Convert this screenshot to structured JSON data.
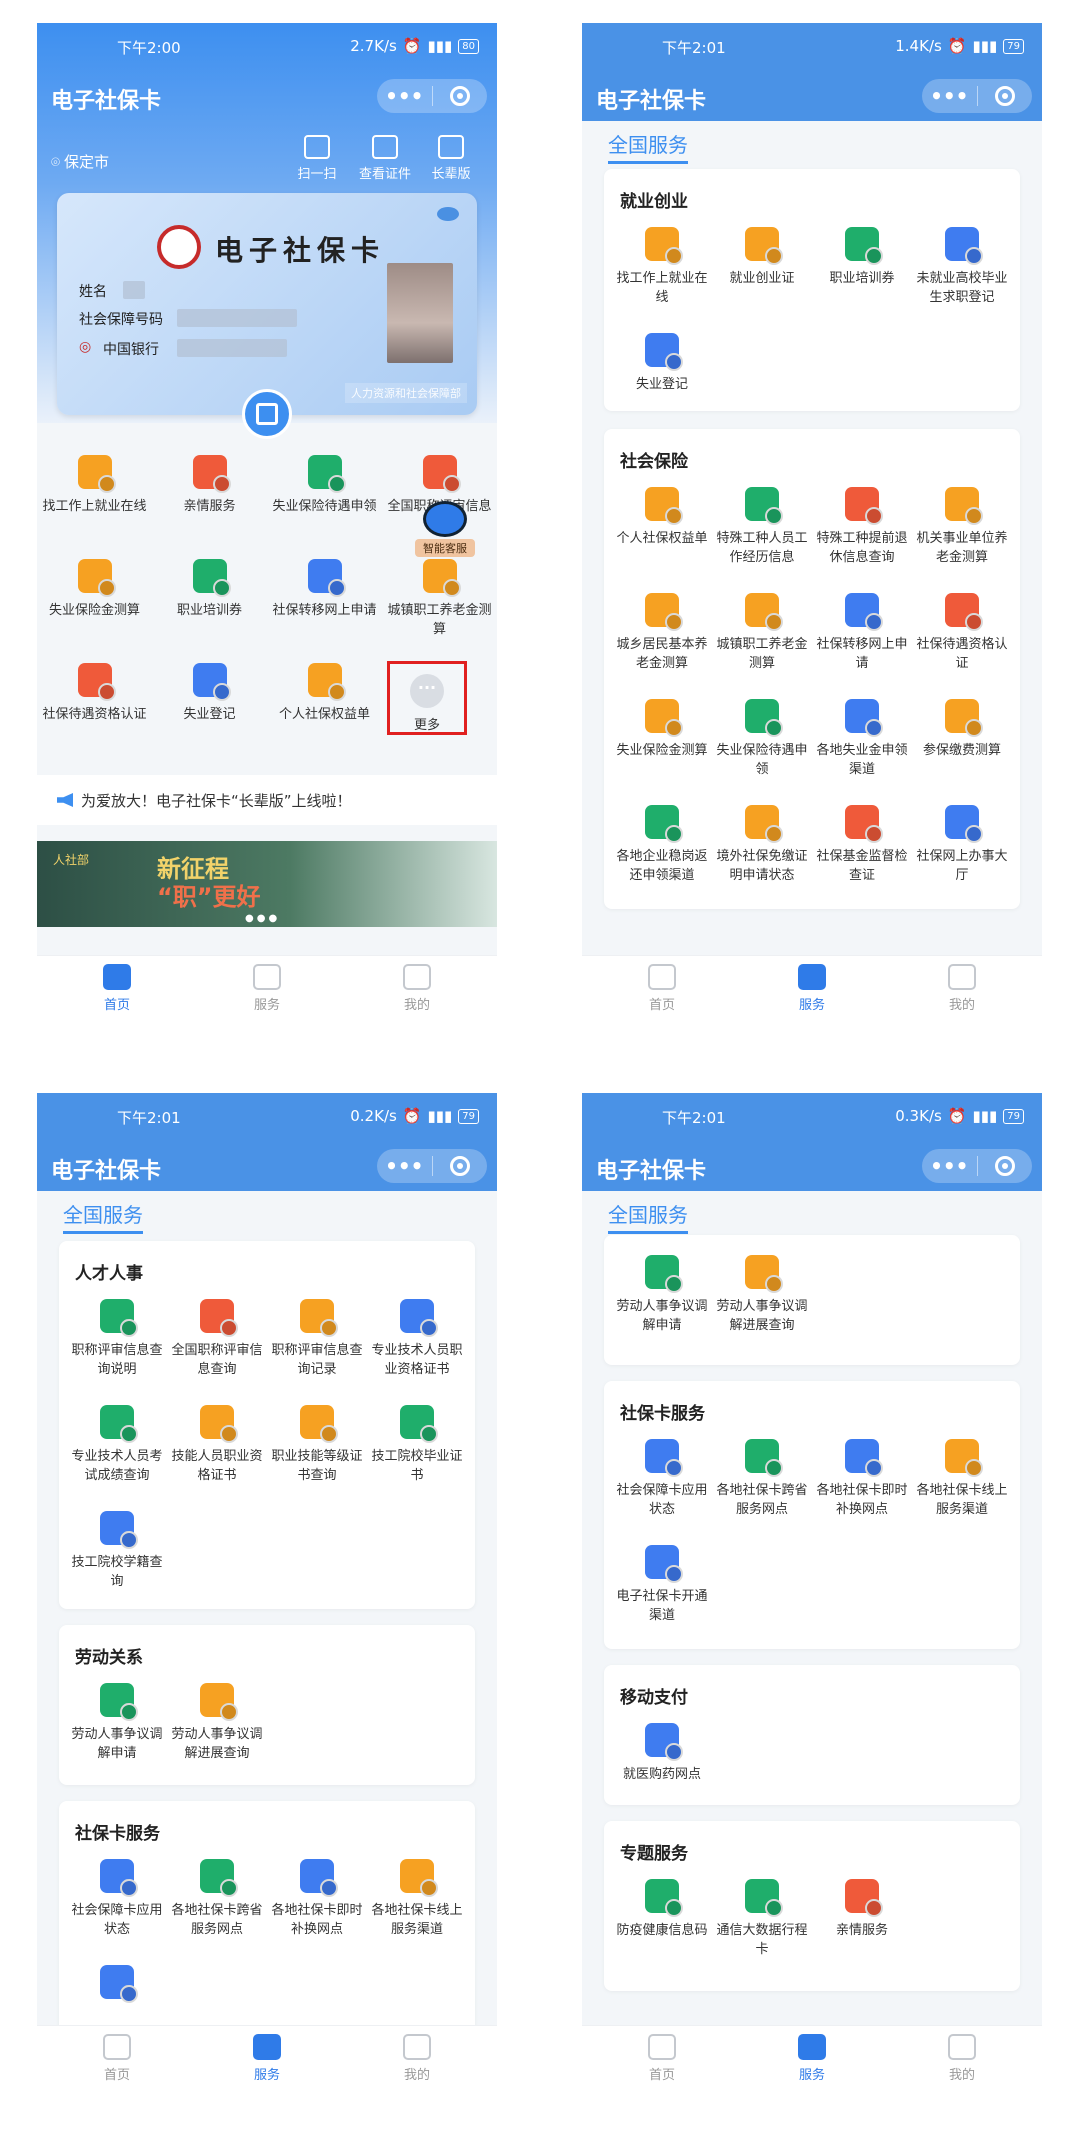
{
  "statusbar": {
    "s1": {
      "time": "下午2:00",
      "speed": "2.7K/s",
      "battery": "80"
    },
    "s2": {
      "time": "下午2:01",
      "speed": "1.4K/s",
      "battery": "79"
    },
    "s3": {
      "time": "下午2:01",
      "speed": "0.2K/s",
      "battery": "79"
    },
    "s4": {
      "time": "下午2:01",
      "speed": "0.3K/s",
      "battery": "79"
    }
  },
  "app_title": "电子社保卡",
  "capsule": {
    "more": "•••"
  },
  "home": {
    "location": "保定市",
    "quick": [
      "扫一扫",
      "查看证件",
      "长辈版"
    ],
    "card": {
      "title": "电子社保卡",
      "name_label": "姓名",
      "ssn_label": "社会保障号码",
      "bank": "中国银行",
      "org": "人力资源和社会保障部"
    },
    "grid": [
      {
        "label": "找工作上就业在线",
        "icon": "red-flag-icon",
        "color": "orange"
      },
      {
        "label": "亲情服务",
        "icon": "heart-icon",
        "color": "red"
      },
      {
        "label": "失业保险待遇申领",
        "icon": "house-person-icon",
        "color": "green"
      },
      {
        "label": "全国职称评审信息查询",
        "icon": "certificate-icon",
        "color": "red"
      },
      {
        "label": "失业保险金测算",
        "icon": "person-calc-icon",
        "color": "orange"
      },
      {
        "label": "职业培训券",
        "icon": "ticket-icon",
        "color": "green"
      },
      {
        "label": "社保转移网上申请",
        "icon": "transfer-icon",
        "color": "blue"
      },
      {
        "label": "城镇职工养老金测算",
        "icon": "elder-icon",
        "color": "orange"
      },
      {
        "label": "社保待遇资格认证",
        "icon": "face-verify-icon",
        "color": "red"
      },
      {
        "label": "失业登记",
        "icon": "person-run-icon",
        "color": "blue"
      },
      {
        "label": "个人社保权益单",
        "icon": "document-edit-icon",
        "color": "orange"
      },
      {
        "label": "更多",
        "icon": "more-dots-icon",
        "color": "gray"
      }
    ],
    "robot_label": "智能客服",
    "notice": "为爱放大！电子社保卡“长辈版”上线啦！",
    "banner": {
      "line1": "新征程",
      "line2": "“职”更好",
      "logo": "人社部"
    }
  },
  "tabs": [
    "首页",
    "服务",
    "我的"
  ],
  "services": {
    "title": "全国服务",
    "employment": {
      "heading": "就业创业",
      "items": [
        "找工作上就业在线",
        "就业创业证",
        "职业培训券",
        "未就业高校毕业生求职登记",
        "失业登记"
      ]
    },
    "social_insurance": {
      "heading": "社会保险",
      "items": [
        "个人社保权益单",
        "特殊工种人员工作经历信息",
        "特殊工种提前退休信息查询",
        "机关事业单位养老金测算",
        "城乡居民基本养老金测算",
        "城镇职工养老金测算",
        "社保转移网上申请",
        "社保待遇资格认证",
        "失业保险金测算",
        "失业保险待遇申领",
        "各地失业金申领渠道",
        "参保缴费测算",
        "各地企业稳岗返还申领渠道",
        "境外社保免缴证明申请状态",
        "社保基金监督检查证",
        "社保网上办事大厅"
      ]
    },
    "talent": {
      "heading": "人才人事",
      "items": [
        "职称评审信息查询说明",
        "全国职称评审信息查询",
        "职称评审信息查询记录",
        "专业技术人员职业资格证书",
        "专业技术人员考试成绩查询",
        "技能人员职业资格证书",
        "职业技能等级证书查询",
        "技工院校毕业证书",
        "技工院校学籍查询"
      ]
    },
    "labor": {
      "heading": "劳动关系",
      "items": [
        "劳动人事争议调解申请",
        "劳动人事争议调解进展查询"
      ]
    },
    "card_service": {
      "heading": "社保卡服务",
      "items": [
        "社会保障卡应用状态",
        "各地社保卡跨省服务网点",
        "各地社保卡即时补换网点",
        "各地社保卡线上服务渠道",
        "电子社保卡开通渠道"
      ]
    },
    "mobile_pay": {
      "heading": "移动支付",
      "items": [
        "就医购药网点"
      ]
    },
    "special": {
      "heading": "专题服务",
      "items": [
        "防疫健康信息码",
        "通信大数据行程卡",
        "亲情服务"
      ]
    }
  }
}
